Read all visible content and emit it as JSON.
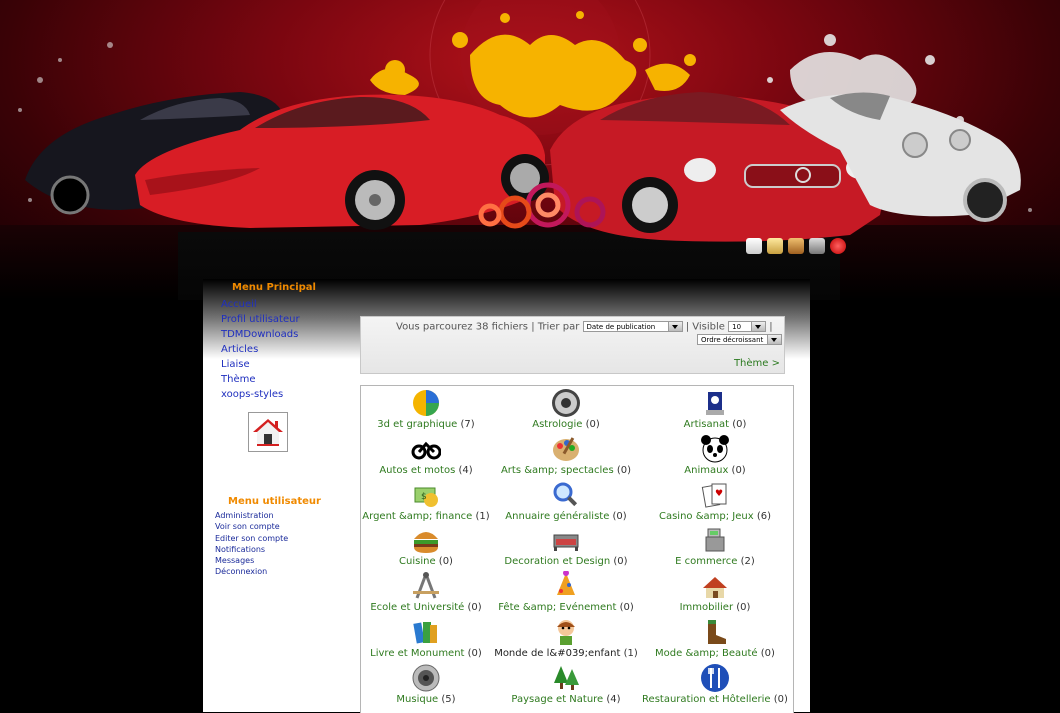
{
  "main_menu": {
    "title": "Menu Principal",
    "items": [
      "Accueil",
      "Profil utilisateur",
      "TDMDownloads",
      "Articles",
      "Liaise",
      "Thème",
      "xoops-styles"
    ]
  },
  "user_menu": {
    "title": "Menu utilisateur",
    "items": [
      "Administration",
      "Voir son compte",
      "Editer son compte",
      "Notifications",
      "Messages",
      "Déconnexion"
    ]
  },
  "sort_bar": {
    "browsing": "Vous parcourez 38 fichiers",
    "sort_label": "Trier par",
    "sort_value": "Date de publication",
    "visible_label": "Visible",
    "visible_value": "10",
    "order_value": "Ordre décroissant",
    "theme_link": "Thème >",
    "sep": "|"
  },
  "categories": [
    {
      "name": "3d et graphique",
      "count": "(7)",
      "icon": "pie-chart-icon"
    },
    {
      "name": "Astrologie",
      "count": "(0)",
      "icon": "astrology-icon"
    },
    {
      "name": "Artisanat",
      "count": "(0)",
      "icon": "artisan-icon"
    },
    {
      "name": "Autos et motos",
      "count": "(4)",
      "icon": "motorbike-icon"
    },
    {
      "name": "Arts &amp; spectacles",
      "count": "(0)",
      "icon": "palette-icon"
    },
    {
      "name": "Animaux",
      "count": "(0)",
      "icon": "panda-icon"
    },
    {
      "name": "Argent &amp; finance",
      "count": "(1)",
      "icon": "money-icon"
    },
    {
      "name": "Annuaire généraliste",
      "count": "(0)",
      "icon": "magnifier-icon"
    },
    {
      "name": "Casino &amp; Jeux",
      "count": "(6)",
      "icon": "cards-icon"
    },
    {
      "name": "Cuisine",
      "count": "(0)",
      "icon": "burger-icon"
    },
    {
      "name": "Decoration et Design",
      "count": "(0)",
      "icon": "sofa-icon"
    },
    {
      "name": "E commerce",
      "count": "(2)",
      "icon": "cash-register-icon"
    },
    {
      "name": "Ecole et Université",
      "count": "(0)",
      "icon": "compass-icon"
    },
    {
      "name": "Fête &amp; Evénement",
      "count": "(0)",
      "icon": "party-icon"
    },
    {
      "name": "Immobilier",
      "count": "(0)",
      "icon": "house-icon"
    },
    {
      "name": "Livre et Monument",
      "count": "(0)",
      "icon": "books-icon"
    },
    {
      "name": "Monde de l&#039;enfant",
      "count": "(1)",
      "icon": "child-icon"
    },
    {
      "name": "Mode &amp; Beauté",
      "count": "(0)",
      "icon": "boot-icon"
    },
    {
      "name": "Musique",
      "count": "(5)",
      "icon": "speaker-icon"
    },
    {
      "name": "Paysage et Nature",
      "count": "(4)",
      "icon": "tree-icon"
    },
    {
      "name": "Restauration et Hôtellerie",
      "count": "(0)",
      "icon": "cutlery-icon"
    }
  ],
  "colors": {
    "accent": "#f08a00",
    "link": "#2f7a1f",
    "menu_link": "#1f2fbf"
  }
}
